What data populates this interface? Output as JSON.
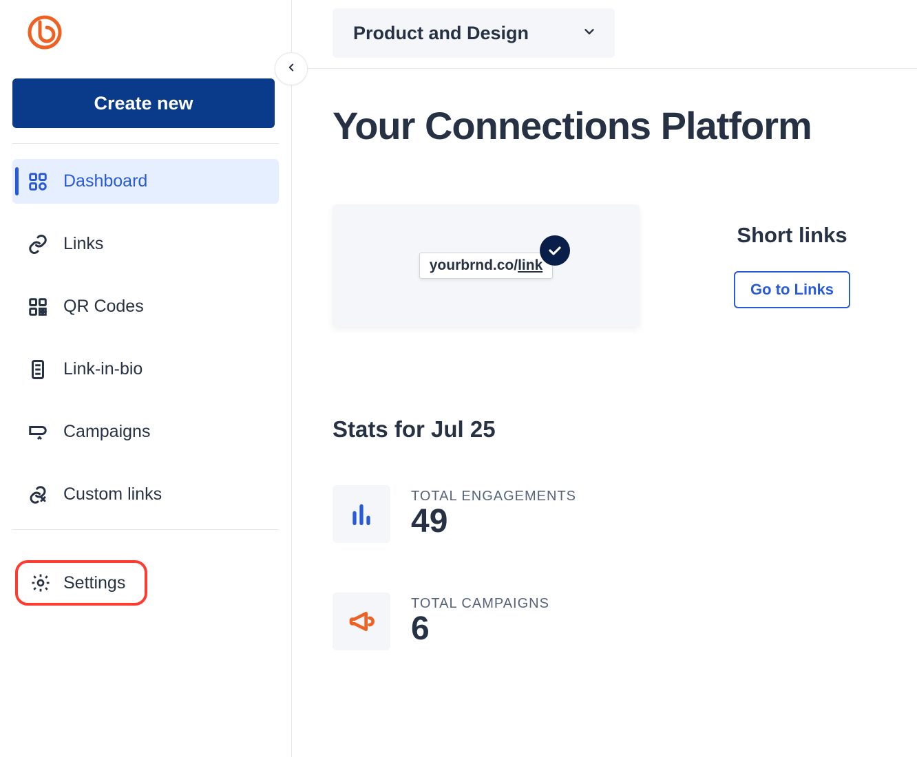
{
  "sidebar": {
    "create_label": "Create new",
    "items": [
      {
        "label": "Dashboard"
      },
      {
        "label": "Links"
      },
      {
        "label": "QR Codes"
      },
      {
        "label": "Link-in-bio"
      },
      {
        "label": "Campaigns"
      },
      {
        "label": "Custom links"
      }
    ],
    "settings_label": "Settings"
  },
  "header": {
    "dropdown_label": "Product and Design"
  },
  "main": {
    "heading": "Your Connections Platform",
    "card": {
      "link_example_domain": "yourbrnd.co/",
      "link_example_slug": "link",
      "title": "Short links",
      "button_label": "Go to Links"
    },
    "stats": {
      "heading": "Stats for Jul 25",
      "rows": [
        {
          "label": "TOTAL ENGAGEMENTS",
          "value": "49"
        },
        {
          "label": "TOTAL CAMPAIGNS",
          "value": "6"
        }
      ]
    }
  }
}
